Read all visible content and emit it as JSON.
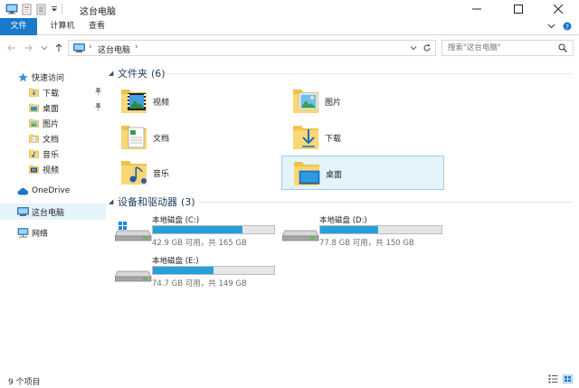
{
  "window": {
    "title": "这台电脑",
    "accent": "#1979ca"
  },
  "ribbon": {
    "tabs": [
      {
        "label": "文件"
      },
      {
        "label": "计算机"
      },
      {
        "label": "查看"
      }
    ]
  },
  "address": {
    "path": "这台电脑",
    "separator": "›"
  },
  "search": {
    "placeholder": "搜索\"这台电脑\""
  },
  "nav": {
    "items": [
      {
        "label": "快速访问",
        "icon": "star-icon"
      },
      {
        "label": "下载",
        "icon": "download-folder-icon",
        "pinned": true
      },
      {
        "label": "桌面",
        "icon": "desktop-folder-icon",
        "pinned": true
      },
      {
        "label": "图片",
        "icon": "pictures-folder-icon"
      },
      {
        "label": "文档",
        "icon": "documents-folder-icon"
      },
      {
        "label": "音乐",
        "icon": "music-folder-icon"
      },
      {
        "label": "视频",
        "icon": "videos-folder-icon"
      },
      {
        "label": "OneDrive",
        "icon": "cloud-icon"
      },
      {
        "label": "这台电脑",
        "icon": "computer-icon",
        "selected": true
      },
      {
        "label": "网络",
        "icon": "network-icon"
      }
    ]
  },
  "folders_group": {
    "title": "文件夹",
    "count": "(6)",
    "items": [
      {
        "label": "视频",
        "icon": "videos-folder-icon"
      },
      {
        "label": "图片",
        "icon": "pictures-folder-icon"
      },
      {
        "label": "文档",
        "icon": "documents-folder-icon"
      },
      {
        "label": "下载",
        "icon": "download-folder-icon"
      },
      {
        "label": "音乐",
        "icon": "music-folder-icon"
      },
      {
        "label": "桌面",
        "icon": "desktop-folder-icon",
        "selected": true
      }
    ]
  },
  "drives_group": {
    "title": "设备和驱动器",
    "count": "(3)",
    "items": [
      {
        "name": "本地磁盘 (C:)",
        "free_text": "42.9 GB 可用，共 165 GB",
        "used_fraction": 0.74
      },
      {
        "name": "本地磁盘 (D:)",
        "free_text": "77.8 GB 可用，共 150 GB",
        "used_fraction": 0.48
      },
      {
        "name": "本地磁盘 (E:)",
        "free_text": "74.7 GB 可用，共 149 GB",
        "used_fraction": 0.5
      }
    ]
  },
  "status": {
    "item_count": "9 个项目"
  }
}
